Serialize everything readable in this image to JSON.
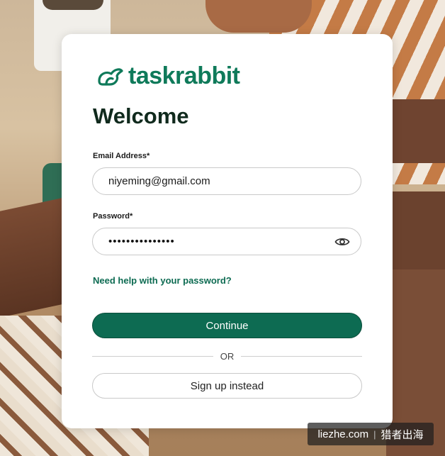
{
  "brand": {
    "name": "taskrabbit",
    "logo_icon": "rabbit-icon",
    "color": "#0f7a5a"
  },
  "login": {
    "title": "Welcome",
    "email_label": "Email Address*",
    "email_value": "niyeming@gmail.com",
    "password_label": "Password*",
    "password_masked": "•••••••••••••••",
    "show_password_icon": "eye-icon",
    "help_link": "Need help with your password?",
    "continue_label": "Continue",
    "divider_text": "OR",
    "signup_label": "Sign up instead",
    "primary_color": "#0d6b52"
  },
  "watermark": {
    "site": "liezhe.com",
    "name": "猎者出海"
  }
}
